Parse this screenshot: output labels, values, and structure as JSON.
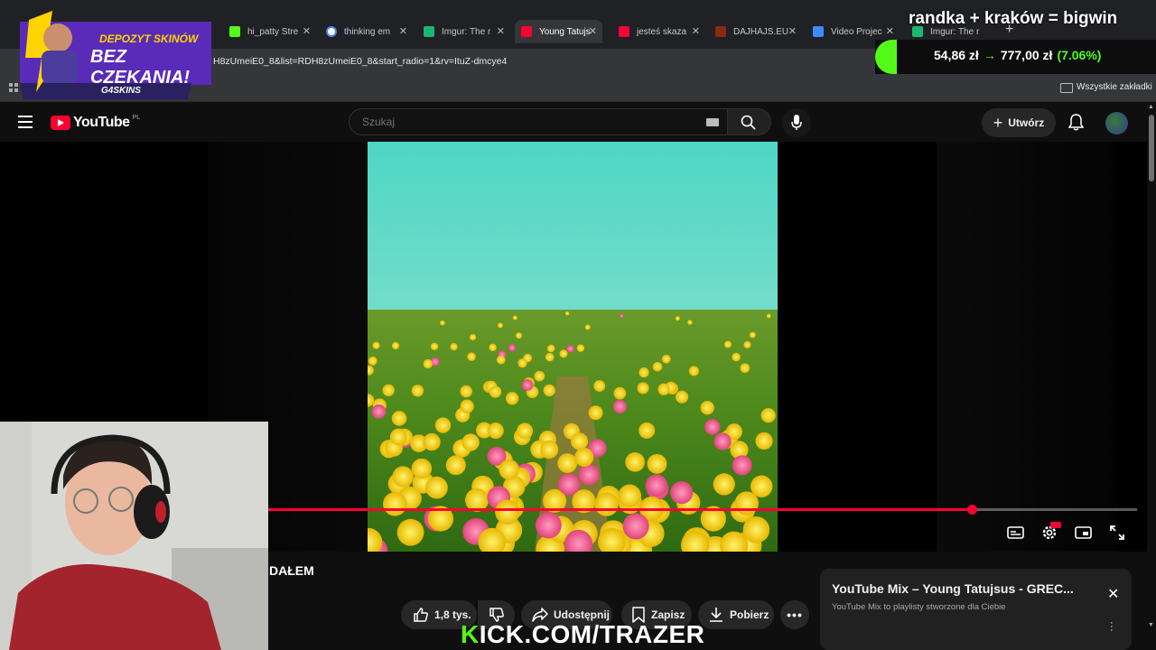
{
  "browser": {
    "tabs": [
      {
        "label": "hi_patty Stre",
        "color": "#53fc18"
      },
      {
        "label": "thinking em",
        "color": "#4285f4"
      },
      {
        "label": "Imgur: The r",
        "color": "#1bb76e"
      },
      {
        "label": "Young Tatujs",
        "color": "#ff0033"
      },
      {
        "label": "jesteś skaza",
        "color": "#ff0033"
      },
      {
        "label": "DAJHAJS.EU",
        "color": "#8b2a12"
      },
      {
        "label": "Video Projec",
        "color": "#3d8bfd"
      },
      {
        "label": "Imgur: The r",
        "color": "#1bb76e"
      }
    ],
    "url": "H8zUmeiE0_8&list=RDH8zUmeiE0_8&start_radio=1&rv=ItuZ-dmcye4",
    "bookmarks_label": "Wszystkie zakładki"
  },
  "stream": {
    "title": "randka + kraków = bigwin",
    "balance": "54,86 zł",
    "arrow": "→",
    "target": "777,00 zł",
    "percent": "(7.06%)",
    "kick": "KICK.COM/TRAZER",
    "kick_k": "K",
    "ad_line1": "DEPOZYT SKINÓW",
    "ad_line2": "BEZ CZEKANIA!",
    "ad_brand": "G4SKINS"
  },
  "youtube": {
    "logo": "YouTube",
    "country": "PL",
    "search_placeholder": "Szukaj",
    "create_label": "Utwórz",
    "video_title_fragment": "DAŁEM",
    "likes": "1,8 tys.",
    "share": "Udostępnij",
    "save": "Zapisz",
    "download": "Pobierz",
    "progress": 0.81,
    "mix_title": "YouTube Mix – Young Tatujsus - GREC...",
    "mix_subtitle": "YouTube Mix to playlisty stworzone dla Ciebie",
    "accent": "#ff0033"
  }
}
